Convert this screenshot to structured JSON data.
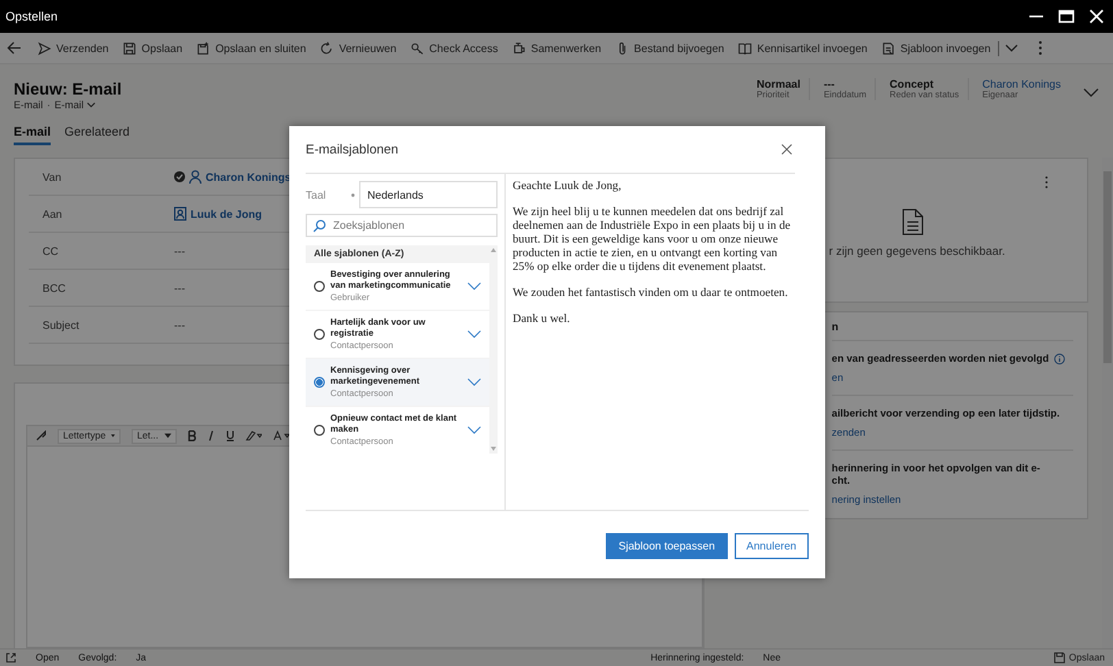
{
  "window": {
    "title": "Opstellen"
  },
  "commands": [
    {
      "label": "Verzenden"
    },
    {
      "label": "Opslaan"
    },
    {
      "label": "Opslaan en sluiten"
    },
    {
      "label": "Vernieuwen"
    },
    {
      "label": "Check Access"
    },
    {
      "label": "Samenwerken"
    },
    {
      "label": "Bestand bijvoegen"
    },
    {
      "label": "Kennisartikel invoegen"
    },
    {
      "label": "Sjabloon invoegen"
    }
  ],
  "record": {
    "title": "Nieuw: E-mail",
    "entity": "E-mail",
    "separator": "·",
    "form": "E-mail",
    "fields": [
      {
        "value": "Normaal",
        "label": "Prioriteit",
        "kind": "text"
      },
      {
        "value": "---",
        "label": "Einddatum",
        "kind": "text"
      },
      {
        "value": "Concept",
        "label": "Reden van status",
        "kind": "text"
      },
      {
        "value": "Charon Konings",
        "label": "Eigenaar",
        "kind": "link"
      }
    ]
  },
  "tabs": [
    {
      "label": "E-mail",
      "selected": true
    },
    {
      "label": "Gerelateerd",
      "selected": false
    }
  ],
  "email_fields": [
    {
      "label": "Van",
      "value": "Charon Konings",
      "kind": "user"
    },
    {
      "label": "Aan",
      "value": "Luuk de Jong",
      "kind": "contact"
    },
    {
      "label": "CC",
      "value": "---",
      "kind": "text"
    },
    {
      "label": "BCC",
      "value": "---",
      "kind": "text"
    },
    {
      "label": "Subject",
      "value": "---",
      "kind": "text"
    }
  ],
  "editor_toolbar": {
    "font": "Lettertype",
    "size": "Let..."
  },
  "side_panel": {
    "empty_message": "r zijn geen gegevens beschikbaar.",
    "section_title": "n",
    "items": [
      {
        "lines": [
          "en van geadresseerden worden niet gevolgd"
        ],
        "info": true,
        "link": "en"
      },
      {
        "lines": [
          "ailbericht voor verzending op een later tijdstip."
        ],
        "info": false,
        "link": "zenden"
      },
      {
        "lines": [
          "herinnering in voor het opvolgen van dit e-",
          "cht."
        ],
        "info": false,
        "link": "nering instellen"
      }
    ]
  },
  "modal": {
    "title": "E-mailsjablonen",
    "language_label": "Taal",
    "required": true,
    "language": "Nederlands",
    "search_placeholder": "Zoeksjablonen",
    "list_header": "Alle sjablonen (A-Z)",
    "templates": [
      {
        "name": "Bevestiging over annulering van marketingcommunicatie",
        "type": "Gebruiker",
        "selected": false
      },
      {
        "name": "Hartelijk dank voor uw registratie",
        "type": "Contactpersoon",
        "selected": false
      },
      {
        "name": "Kennisgeving over marketingevenement",
        "type": "Contactpersoon",
        "selected": true
      },
      {
        "name": "Opnieuw contact met de klant maken",
        "type": "Contactpersoon",
        "selected": false
      }
    ],
    "preview": [
      "Geachte Luuk de Jong,",
      "We zijn heel blij u te kunnen meedelen dat ons bedrijf zal deelnemen aan de Industriële Expo in een plaats bij u in de buurt. Dit is een geweldige kans voor u om onze nieuwe producten in actie te zien, en u ontvangt een korting van 25% op elke order die u tijdens dit evenement plaatst.",
      "We zouden het fantastisch vinden om u daar te ontmoeten.",
      "Dank u wel."
    ],
    "buttons": [
      {
        "label": "Sjabloon toepassen",
        "primary": true
      },
      {
        "label": "Annuleren",
        "primary": false
      }
    ]
  },
  "status_bar": {
    "status": "Open",
    "followed_label": "Gevolgd:",
    "followed": "Ja",
    "reminder_label": "Herinnering ingesteld:",
    "reminder": "Nee",
    "save": "Opslaan"
  }
}
